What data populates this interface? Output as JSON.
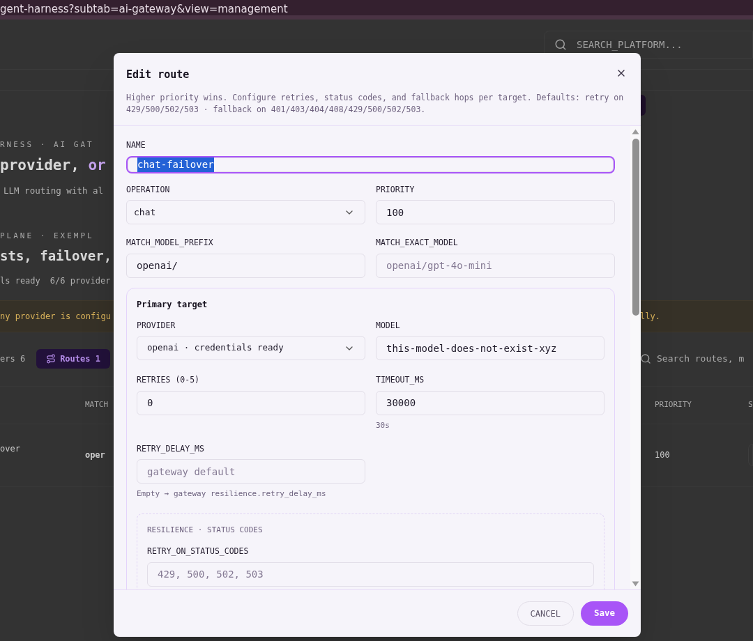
{
  "browser": {
    "address": "gent-harness?subtab=ai-gateway&view=management"
  },
  "background": {
    "search_placeholder": "SEARCH_PLATFORM...",
    "eyebrow_1": "RNESS · AI GAT",
    "heading_1": "provider, ",
    "heading_1_accent": "or",
    "subtitle": "LLM routing with al",
    "eyebrow_2": "PLANE · EXEMPL",
    "heading_2": "sts, failover,",
    "status_1": "ls ready",
    "status_2": "6/6 provider",
    "warning_left": "ny provider is configu",
    "warning_right": "lly.",
    "tabs": [
      {
        "label": "ers 6",
        "selected": false
      },
      {
        "label": "Routes 1",
        "selected": true
      }
    ],
    "table_search_placeholder": "Search routes, m",
    "columns": [
      "MATCH",
      "PRIORITY",
      "S"
    ],
    "row": {
      "name": "over",
      "match": "oper",
      "priority": "100"
    }
  },
  "dialog": {
    "title": "Edit route",
    "description": "Higher priority wins. Configure retries, status codes, and fallback hops per target. Defaults: retry on 429/500/502/503 · fallback on 401/403/404/408/429/500/502/503.",
    "name_field": {
      "label": "NAME",
      "value": "chat-failover",
      "focused": true,
      "text_selected": true
    },
    "field_rows": [
      [
        {
          "label": "OPERATION",
          "kind": "select",
          "value": "chat"
        },
        {
          "label": "PRIORITY",
          "kind": "input",
          "value": "100"
        }
      ],
      [
        {
          "label": "MATCH_MODEL_PREFIX",
          "kind": "input",
          "value": "openai/"
        },
        {
          "label": "MATCH_EXACT_MODEL",
          "kind": "input",
          "placeholder": "openai/gpt-4o-mini"
        }
      ]
    ],
    "primary_target": {
      "title": "Primary target",
      "field_rows": [
        [
          {
            "label": "PROVIDER",
            "kind": "select",
            "value": "openai · credentials ready"
          },
          {
            "label": "MODEL",
            "kind": "input",
            "value": "this-model-does-not-exist-xyz"
          }
        ],
        [
          {
            "label": "RETRIES (0-5)",
            "kind": "input",
            "value": "0"
          },
          {
            "label": "TIMEOUT_MS",
            "kind": "input",
            "value": "30000",
            "hint": "30s"
          }
        ],
        [
          {
            "label": "RETRY_DELAY_MS",
            "kind": "input",
            "placeholder": "gateway default",
            "hint": "Empty → gateway resilience.retry_delay_ms"
          }
        ]
      ],
      "resilience": {
        "title": "RESILIENCE · STATUS CODES",
        "fields": [
          {
            "label": "RETRY_ON_STATUS_CODES",
            "kind": "input",
            "placeholder": "429, 500, 502, 503"
          }
        ]
      }
    },
    "buttons": [
      {
        "label": "CANCEL",
        "kind": "secondary"
      },
      {
        "label": "Save",
        "kind": "primary"
      }
    ]
  }
}
